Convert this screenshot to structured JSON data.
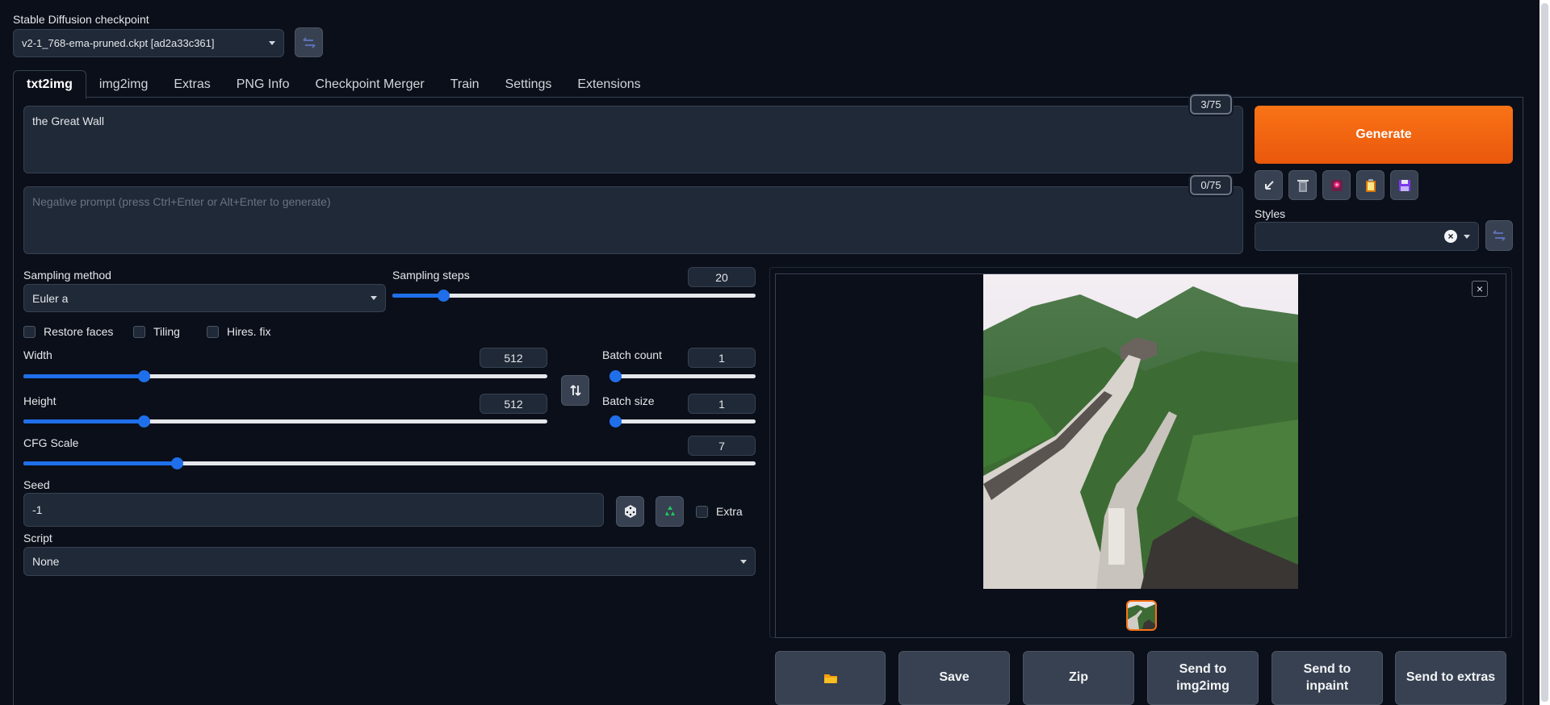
{
  "checkpoint": {
    "label": "Stable Diffusion checkpoint",
    "value": "v2-1_768-ema-pruned.ckpt [ad2a33c361]"
  },
  "tabs": [
    {
      "label": "txt2img"
    },
    {
      "label": "img2img"
    },
    {
      "label": "Extras"
    },
    {
      "label": "PNG Info"
    },
    {
      "label": "Checkpoint Merger"
    },
    {
      "label": "Train"
    },
    {
      "label": "Settings"
    },
    {
      "label": "Extensions"
    }
  ],
  "prompt": {
    "value": "the Great Wall",
    "counter": "3/75"
  },
  "negative_prompt": {
    "placeholder": "Negative prompt (press Ctrl+Enter or Alt+Enter to generate)",
    "counter": "0/75"
  },
  "generate_label": "Generate",
  "styles_label": "Styles",
  "sampling": {
    "method_label": "Sampling method",
    "method_value": "Euler a",
    "steps_label": "Sampling steps",
    "steps_value": "20",
    "steps_fraction": 0.14
  },
  "checks": {
    "restore_faces": "Restore faces",
    "tiling": "Tiling",
    "hires_fix": "Hires. fix"
  },
  "width": {
    "label": "Width",
    "value": "512",
    "fraction": 0.23
  },
  "height": {
    "label": "Height",
    "value": "512",
    "fraction": 0.23
  },
  "batch_count": {
    "label": "Batch count",
    "value": "1",
    "fraction": 0.0
  },
  "batch_size": {
    "label": "Batch size",
    "value": "1",
    "fraction": 0.0
  },
  "cfg": {
    "label": "CFG Scale",
    "value": "7",
    "fraction": 0.21
  },
  "seed": {
    "label": "Seed",
    "value": "-1",
    "extra_label": "Extra"
  },
  "script": {
    "label": "Script",
    "value": "None"
  },
  "output_buttons": {
    "save": "Save",
    "zip": "Zip",
    "send_img2img_1": "Send to",
    "send_img2img_2": "img2img",
    "send_inpaint_1": "Send to",
    "send_inpaint_2": "inpaint",
    "send_extras": "Send to extras"
  },
  "colors": {
    "accent": "#f97316",
    "slider": "#1f6feb",
    "background": "#0b0f19"
  }
}
